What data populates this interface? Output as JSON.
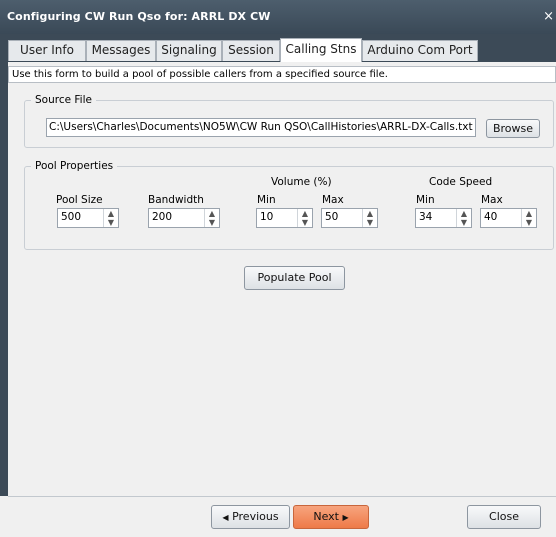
{
  "window": {
    "title": "Configuring CW Run Qso for: ARRL DX CW",
    "close_glyph": "×"
  },
  "tabs": [
    {
      "label": "User Info"
    },
    {
      "label": "Messages"
    },
    {
      "label": "Signaling"
    },
    {
      "label": "Session"
    },
    {
      "label": "Calling Stns"
    },
    {
      "label": "Arduino Com Port"
    }
  ],
  "form": {
    "description": "Use this form to build a pool of possible callers from a specified source file."
  },
  "source_file": {
    "title": "Source File",
    "path": "C:\\Users\\Charles\\Documents\\NO5W\\CW Run QSO\\CallHistories\\ARRL-DX-Calls.txt",
    "browse_label": "Browse"
  },
  "pool": {
    "title": "Pool Properties",
    "pool_size_label": "Pool Size",
    "pool_size": "500",
    "bandwidth_label": "Bandwidth",
    "bandwidth": "200",
    "volume_label": "Volume (%)",
    "volume_min_label": "Min",
    "volume_min": "10",
    "volume_max_label": "Max",
    "volume_max": "50",
    "speed_label": "Code Speed",
    "speed_min_label": "Min",
    "speed_min": "34",
    "speed_max_label": "Max",
    "speed_max": "40",
    "populate_label": "Populate Pool"
  },
  "footer": {
    "previous_label": "Previous",
    "next_label": "Next",
    "close_label": "Close"
  },
  "colors": {
    "titlebar": "#3d4c5a",
    "next_button": "#f28a5c"
  }
}
